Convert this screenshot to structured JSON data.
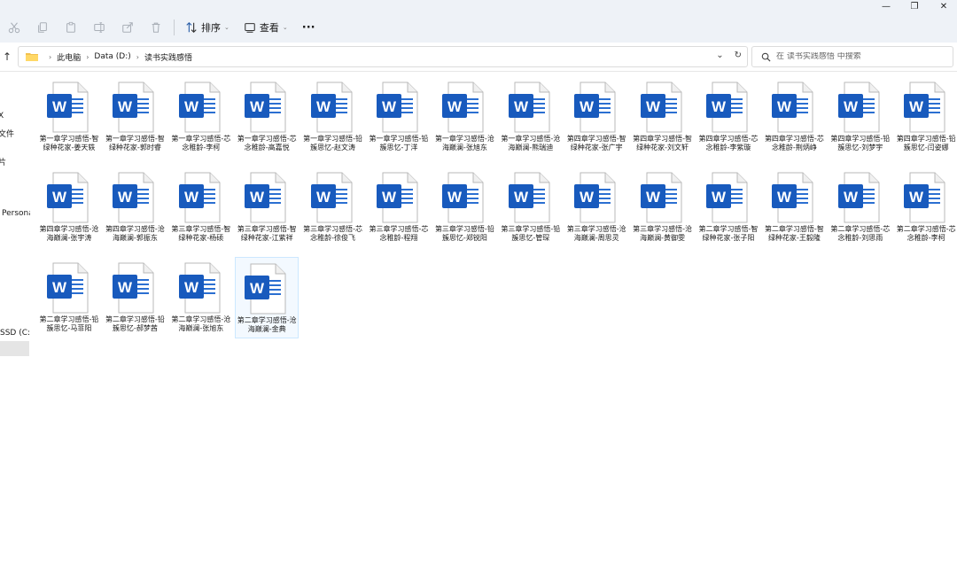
{
  "window": {
    "controls": {
      "minimize": "—",
      "maximize": "❐",
      "close": "✕"
    }
  },
  "toolbar": {
    "sort_label": "排序",
    "view_label": "查看",
    "more_label": "···"
  },
  "address": {
    "segments": [
      "此电脑",
      "Data (D:)",
      "读书实践感悟"
    ]
  },
  "search": {
    "placeholder": "在 读书实践感悟 中搜索"
  },
  "navpane": {
    "items": [
      "Ⅹ",
      "文件",
      "片",
      "Persona",
      "SSD (C:)"
    ]
  },
  "files": [
    {
      "name": "第一章学习感悟-智绿种花家-姜天轶",
      "icon": "word-doc-icon"
    },
    {
      "name": "第一章学习感悟-智绿种花家-郭时睿",
      "icon": "word-doc-icon"
    },
    {
      "name": "第一章学习感悟-芯念稚龄-李柯",
      "icon": "word-doc-icon"
    },
    {
      "name": "第一章学习感悟-芯念稚龄-高嘉悦",
      "icon": "word-doc-icon"
    },
    {
      "name": "第一章学习感悟-铅簇思忆-赵文涛",
      "icon": "word-doc-icon"
    },
    {
      "name": "第一章学习感悟-铅簇思忆-丁洋",
      "icon": "word-doc-icon"
    },
    {
      "name": "第一章学习感悟-沧海巅澜-张旭东",
      "icon": "word-doc-icon"
    },
    {
      "name": "第一章学习感悟-沧海巅澜-熊瑞迪",
      "icon": "word-doc-icon"
    },
    {
      "name": "第四章学习感悟-智绿种花家-张广宇",
      "icon": "word-doc-icon"
    },
    {
      "name": "第四章学习感悟-智绿种花家-刘文轩",
      "icon": "word-doc-icon"
    },
    {
      "name": "第四章学习感悟-芯念稚龄-李紫璇",
      "icon": "word-doc-icon"
    },
    {
      "name": "第四章学习感悟-芯念稚龄-荆炳峥",
      "icon": "word-doc-icon"
    },
    {
      "name": "第四章学习感悟-铅簇思忆-刘梦宇",
      "icon": "word-doc-icon"
    },
    {
      "name": "第四章学习感悟-铅簇思忆-闫姿娜",
      "icon": "word-doc-icon"
    },
    {
      "name": "第四章学习感悟-沧海巅澜-张宇涛",
      "icon": "word-doc-icon"
    },
    {
      "name": "第四章学习感悟-沧海巅澜-郭振东",
      "icon": "word-doc-icon"
    },
    {
      "name": "第三章学习感悟-智绿种花家-杨硕",
      "icon": "word-doc-icon"
    },
    {
      "name": "第三章学习感悟-智绿种花家-江紫祥",
      "icon": "word-doc-icon"
    },
    {
      "name": "第三章学习感悟-芯念稚龄-徐俊飞",
      "icon": "word-doc-icon"
    },
    {
      "name": "第三章学习感悟-芯念稚龄-程翔",
      "icon": "word-doc-icon"
    },
    {
      "name": "第三章学习感悟-铅簇思忆-郑锐阳",
      "icon": "word-doc-icon"
    },
    {
      "name": "第三章学习感悟-铅簇思忆-管琛",
      "icon": "word-doc-icon"
    },
    {
      "name": "第三章学习感悟-沧海巅澜-周思灵",
      "icon": "word-doc-icon"
    },
    {
      "name": "第三章学习感悟-沧海巅澜-黄御雯",
      "icon": "word-doc-icon"
    },
    {
      "name": "第二章学习感悟-智绿种花家-张子阳",
      "icon": "word-doc-icon"
    },
    {
      "name": "第二章学习感悟-智绿种花家-王毅隆",
      "icon": "word-doc-icon"
    },
    {
      "name": "第二章学习感悟-芯念稚龄-刘思雨",
      "icon": "word-doc-icon"
    },
    {
      "name": "第二章学习感悟-芯念稚龄-李柯",
      "icon": "word-doc-icon"
    },
    {
      "name": "第二章学习感悟-铅簇思忆-马菲阳",
      "icon": "word-doc-icon"
    },
    {
      "name": "第二章学习感悟-铅簇思忆-郝梦茜",
      "icon": "word-doc-icon"
    },
    {
      "name": "第二章学习感悟-沧海巅澜-张旭东",
      "icon": "word-doc-icon"
    },
    {
      "name": "第二章学习感悟-沧海巅澜-金典",
      "icon": "word-doc-icon"
    }
  ],
  "selected_file_index": 31,
  "colors": {
    "word_blue": "#185abd",
    "selection_bg": "#f3f9ff",
    "selection_border": "#cce8ff",
    "chrome_bg": "#eef2f7"
  }
}
